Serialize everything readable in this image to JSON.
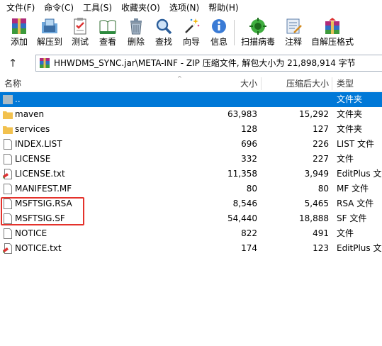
{
  "menu": [
    "文件(F)",
    "命令(C)",
    "工具(S)",
    "收藏夹(O)",
    "选项(N)",
    "帮助(H)"
  ],
  "toolbar": {
    "add": "添加",
    "extract_to": "解压到",
    "test": "测试",
    "view": "查看",
    "delete": "删除",
    "find": "查找",
    "wizard": "向导",
    "info": "信息",
    "virus_scan": "扫描病毒",
    "comment": "注释",
    "sfx": "自解压格式"
  },
  "address": {
    "path": "HHWDMS_SYNC.jar\\META-INF - ZIP 压缩文件, 解包大小为 21,898,914 字节"
  },
  "columns": {
    "name": "名称",
    "size": "大小",
    "packed": "压缩后大小",
    "type": "类型"
  },
  "files": [
    {
      "name": "..",
      "size": "",
      "packed": "",
      "type": "文件夹",
      "icon": "parent-folder-icon",
      "selected": true
    },
    {
      "name": "maven",
      "size": "63,983",
      "packed": "15,292",
      "type": "文件夹",
      "icon": "folder-icon"
    },
    {
      "name": "services",
      "size": "128",
      "packed": "127",
      "type": "文件夹",
      "icon": "folder-icon"
    },
    {
      "name": "INDEX.LIST",
      "size": "696",
      "packed": "226",
      "type": "LIST 文件",
      "icon": "file-icon"
    },
    {
      "name": "LICENSE",
      "size": "332",
      "packed": "227",
      "type": "文件",
      "icon": "file-icon"
    },
    {
      "name": "LICENSE.txt",
      "size": "11,358",
      "packed": "3,949",
      "type": "EditPlus 文",
      "icon": "editplus-file-icon"
    },
    {
      "name": "MANIFEST.MF",
      "size": "80",
      "packed": "80",
      "type": "MF 文件",
      "icon": "file-icon"
    },
    {
      "name": "MSFTSIG.RSA",
      "size": "8,546",
      "packed": "5,465",
      "type": "RSA 文件",
      "icon": "file-icon"
    },
    {
      "name": "MSFTSIG.SF",
      "size": "54,440",
      "packed": "18,888",
      "type": "SF 文件",
      "icon": "file-icon"
    },
    {
      "name": "NOTICE",
      "size": "822",
      "packed": "491",
      "type": "文件",
      "icon": "file-icon"
    },
    {
      "name": "NOTICE.txt",
      "size": "174",
      "packed": "123",
      "type": "EditPlus 文",
      "icon": "editplus-file-icon"
    }
  ],
  "colors": {
    "selection": "#0078d7",
    "highlight_box": "#e4322b",
    "folder": "#f2c14e"
  }
}
